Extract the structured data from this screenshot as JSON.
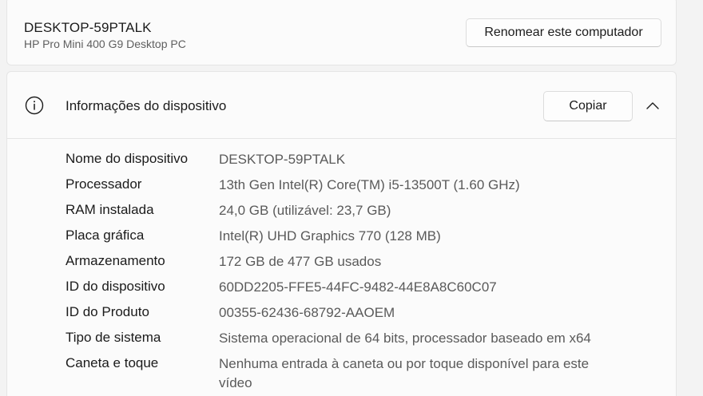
{
  "computer": {
    "name": "DESKTOP-59PTALK",
    "model": "HP Pro Mini 400 G9 Desktop PC",
    "rename_label": "Renomear este computador"
  },
  "device_info": {
    "title": "Informações do dispositivo",
    "copy_label": "Copiar",
    "specs": [
      {
        "label": "Nome do dispositivo",
        "value": "DESKTOP-59PTALK"
      },
      {
        "label": "Processador",
        "value": "13th Gen Intel(R) Core(TM) i5-13500T (1.60 GHz)"
      },
      {
        "label": "RAM instalada",
        "value": "24,0 GB (utilizável: 23,7 GB)"
      },
      {
        "label": "Placa gráfica",
        "value": "Intel(R) UHD Graphics 770 (128 MB)"
      },
      {
        "label": "Armazenamento",
        "value": "172 GB de 477 GB usados"
      },
      {
        "label": "ID do dispositivo",
        "value": "60DD2205-FFE5-44FC-9482-44E8A8C60C07"
      },
      {
        "label": "ID do Produto",
        "value": "00355-62436-68792-AAOEM"
      },
      {
        "label": "Tipo de sistema",
        "value": "Sistema operacional de 64 bits, processador baseado em x64"
      },
      {
        "label": "Caneta e toque",
        "value": "Nenhuma entrada à caneta ou por toque disponível para este vídeo"
      }
    ]
  },
  "icons": {
    "info": "info-circle-icon",
    "chevron": "chevron-up-icon"
  },
  "colors": {
    "background": "#f3f3f3",
    "card": "#fbfbfb",
    "primary_text": "#1b1b1b",
    "secondary_text": "#5a5a5a"
  }
}
